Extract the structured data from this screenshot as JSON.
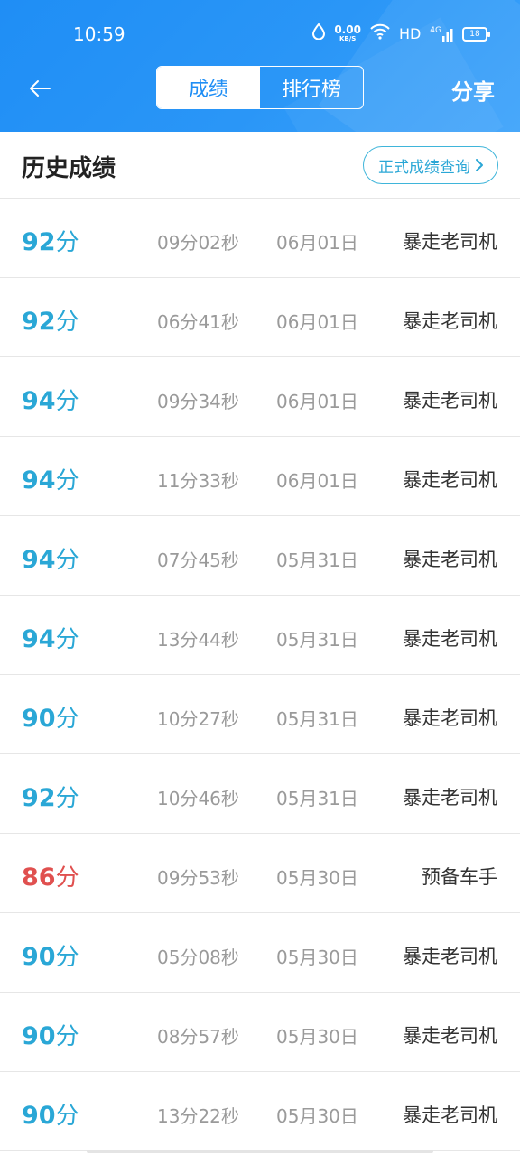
{
  "status_bar": {
    "time": "10:59",
    "net_speed_value": "0.00",
    "net_speed_unit": "KB/S",
    "hd": "HD",
    "signal": "4G",
    "battery": "18"
  },
  "header": {
    "tabs": [
      {
        "label": "成绩",
        "active": true
      },
      {
        "label": "排行榜",
        "active": false
      }
    ],
    "share_label": "分享"
  },
  "section": {
    "title": "历史成绩",
    "query_button": "正式成绩查询"
  },
  "records": [
    {
      "score": "92",
      "unit": "分",
      "duration": "09分02秒",
      "date": "06月01日",
      "title": "暴走老司机",
      "pass": true
    },
    {
      "score": "92",
      "unit": "分",
      "duration": "06分41秒",
      "date": "06月01日",
      "title": "暴走老司机",
      "pass": true
    },
    {
      "score": "94",
      "unit": "分",
      "duration": "09分34秒",
      "date": "06月01日",
      "title": "暴走老司机",
      "pass": true
    },
    {
      "score": "94",
      "unit": "分",
      "duration": "11分33秒",
      "date": "06月01日",
      "title": "暴走老司机",
      "pass": true
    },
    {
      "score": "94",
      "unit": "分",
      "duration": "07分45秒",
      "date": "05月31日",
      "title": "暴走老司机",
      "pass": true
    },
    {
      "score": "94",
      "unit": "分",
      "duration": "13分44秒",
      "date": "05月31日",
      "title": "暴走老司机",
      "pass": true
    },
    {
      "score": "90",
      "unit": "分",
      "duration": "10分27秒",
      "date": "05月31日",
      "title": "暴走老司机",
      "pass": true
    },
    {
      "score": "92",
      "unit": "分",
      "duration": "10分46秒",
      "date": "05月31日",
      "title": "暴走老司机",
      "pass": true
    },
    {
      "score": "86",
      "unit": "分",
      "duration": "09分53秒",
      "date": "05月30日",
      "title": "预备车手",
      "pass": false
    },
    {
      "score": "90",
      "unit": "分",
      "duration": "05分08秒",
      "date": "05月30日",
      "title": "暴走老司机",
      "pass": true
    },
    {
      "score": "90",
      "unit": "分",
      "duration": "08分57秒",
      "date": "05月30日",
      "title": "暴走老司机",
      "pass": true
    },
    {
      "score": "90",
      "unit": "分",
      "duration": "13分22秒",
      "date": "05月30日",
      "title": "暴走老司机",
      "pass": true
    }
  ],
  "colors": {
    "header_blue": "#1f8ef5",
    "pass_score": "#2aa7d6",
    "fail_score": "#e0504f"
  }
}
